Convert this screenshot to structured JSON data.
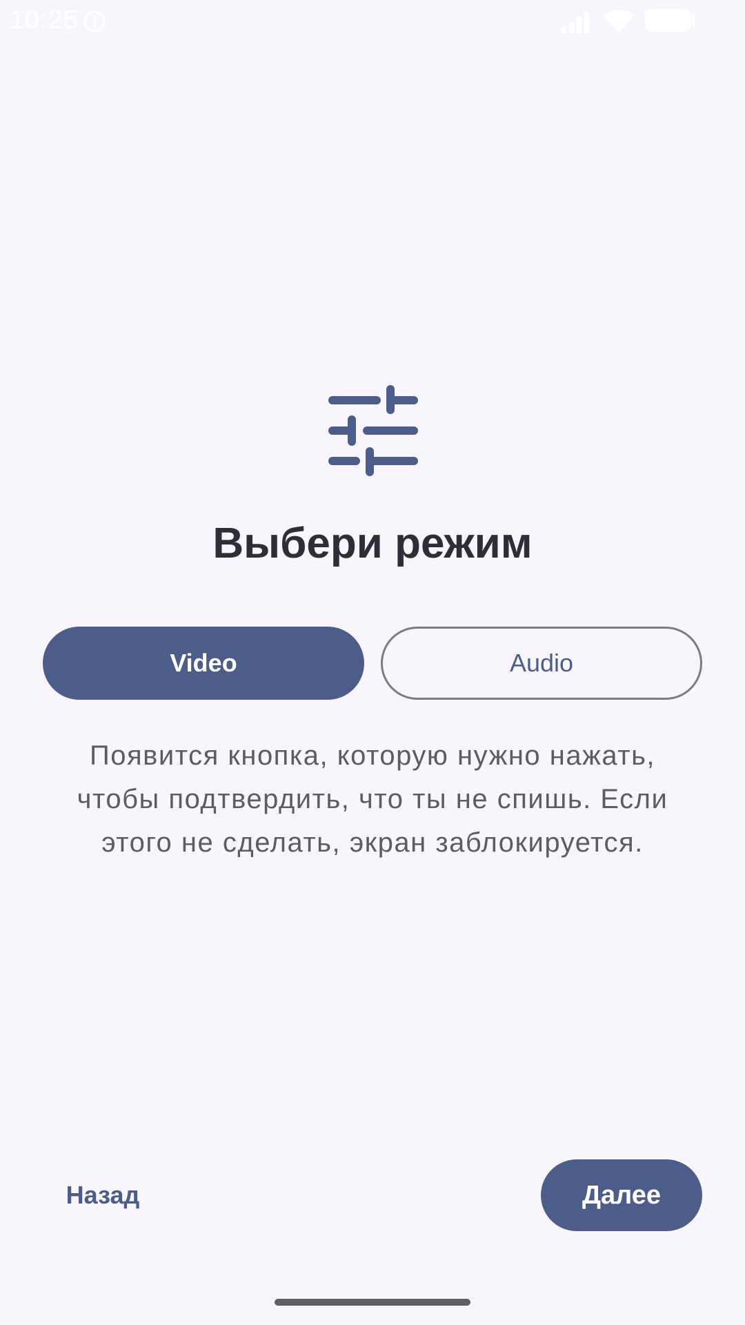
{
  "status_bar": {
    "time": "10:25",
    "icons": [
      "info-icon",
      "signal-icon",
      "wifi-icon",
      "battery-icon"
    ]
  },
  "main": {
    "icon": "tune-icon",
    "title": "Выбери режим",
    "modes": [
      {
        "label": "Video",
        "selected": true
      },
      {
        "label": "Audio",
        "selected": false
      }
    ],
    "description": "Появится кнопка, которую нужно нажать, чтобы подтвердить, что ты не спишь. Если этого не сделать, экран заблокируется."
  },
  "footer": {
    "back_label": "Назад",
    "next_label": "Далее"
  },
  "colors": {
    "background": "#f8f6fc",
    "primary": "#4d5d8a",
    "title_text": "#2e2f36",
    "body_text": "#5c5c62",
    "outline": "#7c7c80"
  }
}
